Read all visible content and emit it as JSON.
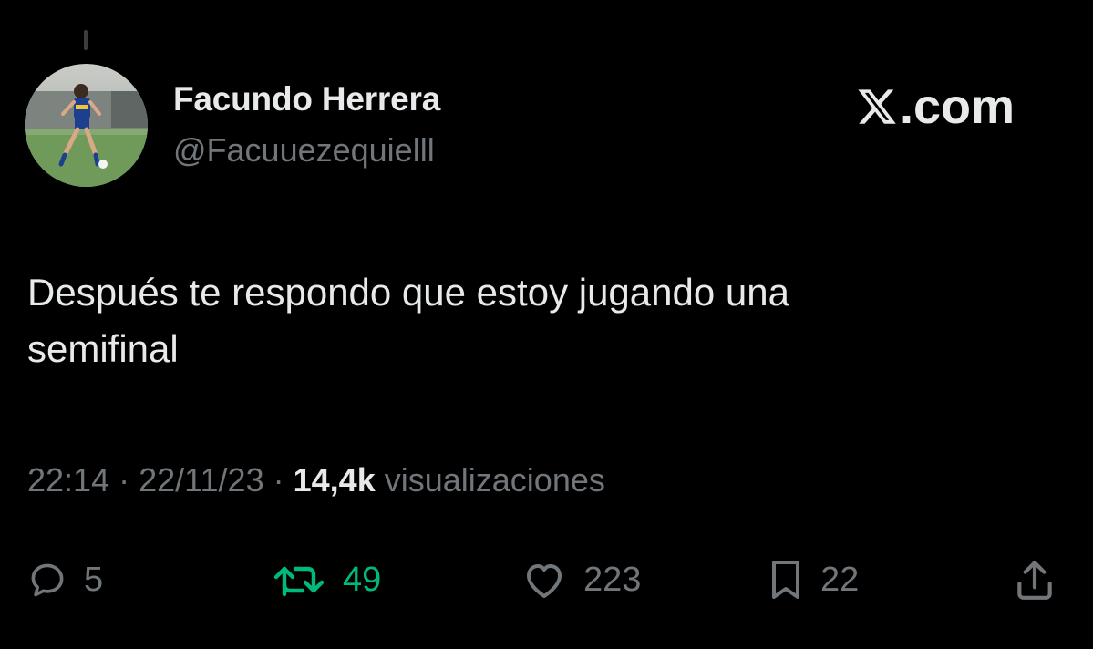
{
  "author": {
    "display_name": "Facundo Herrera",
    "handle": "@Facuuezequielll"
  },
  "brand": {
    "text": ".com",
    "icon": "x-logo-icon"
  },
  "tweet": {
    "text_line1": "Después te respondo que estoy jugando una",
    "text_line2": "semifinal"
  },
  "meta": {
    "time": "22:14",
    "separator": "·",
    "date": "22/11/23",
    "views_count": "14,4k",
    "views_label": "visualizaciones"
  },
  "actions": {
    "reply": {
      "icon": "reply-icon",
      "count": "5"
    },
    "retweet": {
      "icon": "retweet-icon",
      "count": "49",
      "color": "#00ba7c"
    },
    "like": {
      "icon": "heart-icon",
      "count": "223"
    },
    "bookmark": {
      "icon": "bookmark-icon",
      "count": "22"
    },
    "share": {
      "icon": "share-icon"
    }
  },
  "colors": {
    "background": "#000000",
    "text_primary": "#e7e9ea",
    "text_secondary": "#71767b",
    "retweet_active": "#00ba7c"
  }
}
